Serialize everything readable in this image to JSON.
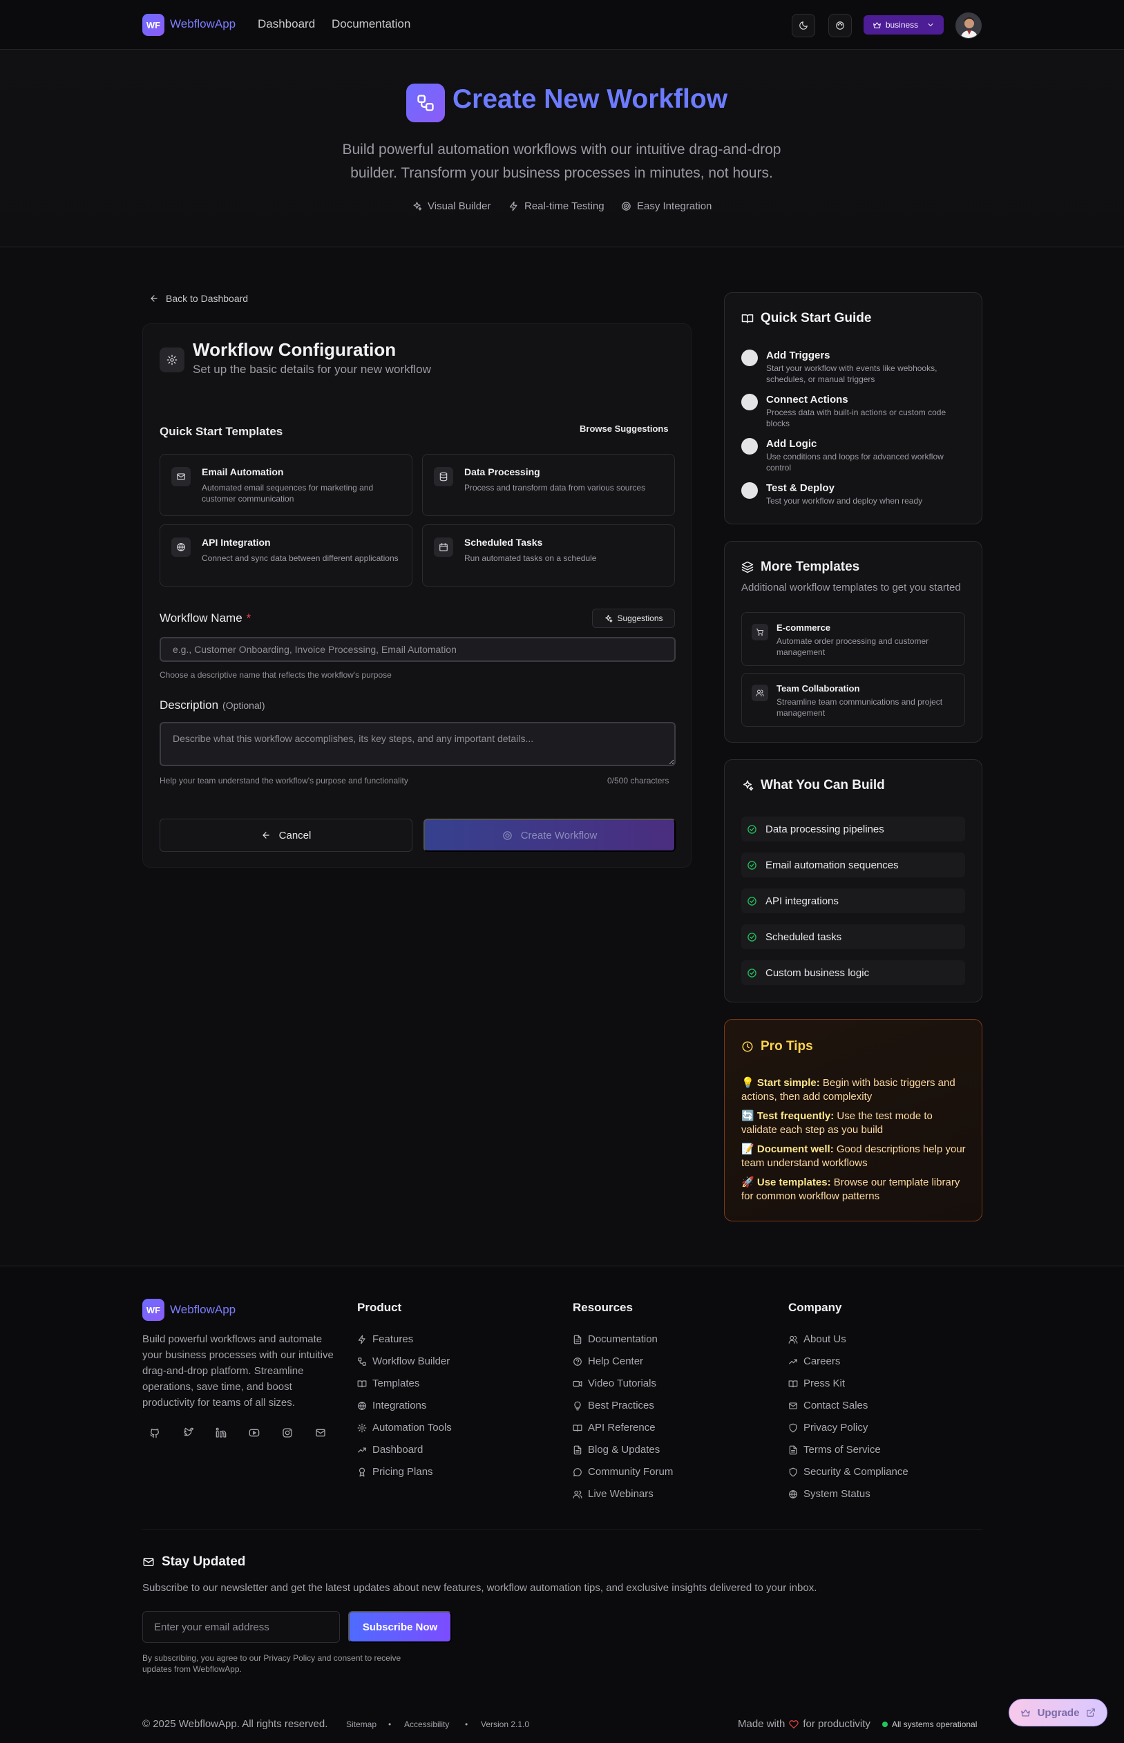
{
  "brand": {
    "logo_initials": "WF",
    "name": "WebflowApp",
    "accent": "#6d6cff"
  },
  "nav": {
    "links": [
      "Dashboard",
      "Documentation"
    ],
    "plan_badge": "business",
    "icons": [
      "moon-icon",
      "palette-icon",
      "crown-icon",
      "chevron-down-icon"
    ]
  },
  "hero": {
    "title": "Create New Workflow",
    "subtitle": "Build powerful automation workflows with our intuitive drag-and-drop builder. Transform your business processes in minutes, not hours.",
    "features": [
      "Visual Builder",
      "Real-time Testing",
      "Easy Integration"
    ]
  },
  "back_link": "Back to Dashboard",
  "config": {
    "title": "Workflow Configuration",
    "subtitle": "Set up the basic details for your new workflow",
    "templates_heading": "Quick Start Templates",
    "browse_label": "Browse Suggestions",
    "templates": [
      {
        "title": "Email Automation",
        "desc": "Automated email sequences for marketing and customer communication",
        "icon": "mail-icon"
      },
      {
        "title": "Data Processing",
        "desc": "Process and transform data from various sources",
        "icon": "database-icon"
      },
      {
        "title": "API Integration",
        "desc": "Connect and sync data between different applications",
        "icon": "globe-icon"
      },
      {
        "title": "Scheduled Tasks",
        "desc": "Run automated tasks on a schedule",
        "icon": "calendar-icon"
      }
    ],
    "name_label": "Workflow Name",
    "name_required": "*",
    "suggestions_label": "Suggestions",
    "name_placeholder": "e.g., Customer Onboarding, Invoice Processing, Email Automation",
    "name_value": "",
    "name_hint": "Choose a descriptive name that reflects the workflow's purpose",
    "desc_label": "Description",
    "desc_optional": "(Optional)",
    "desc_placeholder": "Describe what this workflow accomplishes, its key steps, and any important details...",
    "desc_value": "",
    "desc_hint": "Help your team understand the workflow's purpose and functionality",
    "char_count": "0/500 characters",
    "cancel_label": "Cancel",
    "create_label": "Create Workflow"
  },
  "quick_start": {
    "title": "Quick Start Guide",
    "steps": [
      {
        "title": "Add Triggers",
        "desc": "Start your workflow with events like webhooks, schedules, or manual triggers"
      },
      {
        "title": "Connect Actions",
        "desc": "Process data with built-in actions or custom code blocks"
      },
      {
        "title": "Add Logic",
        "desc": "Use conditions and loops for advanced workflow control"
      },
      {
        "title": "Test & Deploy",
        "desc": "Test your workflow and deploy when ready"
      }
    ]
  },
  "more_templates": {
    "title": "More Templates",
    "subtitle": "Additional workflow templates to get you started",
    "items": [
      {
        "title": "E-commerce",
        "desc": "Automate order processing and customer management",
        "icon": "cart-icon"
      },
      {
        "title": "Team Collaboration",
        "desc": "Streamline team communications and project management",
        "icon": "users-icon"
      }
    ]
  },
  "build": {
    "title": "What You Can Build",
    "items": [
      "Data processing pipelines",
      "Email automation sequences",
      "API integrations",
      "Scheduled tasks",
      "Custom business logic"
    ]
  },
  "tips": {
    "title": "Pro Tips",
    "items": [
      {
        "emoji": "💡",
        "bold": "Start simple:",
        "text": " Begin with basic triggers and actions, then add complexity"
      },
      {
        "emoji": "🔄",
        "bold": "Test frequently:",
        "text": " Use the test mode to validate each step as you build"
      },
      {
        "emoji": "📝",
        "bold": "Document well:",
        "text": " Good descriptions help your team understand workflows"
      },
      {
        "emoji": "🚀",
        "bold": "Use templates:",
        "text": " Browse our template library for common workflow patterns"
      }
    ]
  },
  "footer": {
    "description": "Build powerful workflows and automate your business processes with our intuitive drag-and-drop platform. Streamline operations, save time, and boost productivity for teams of all sizes.",
    "social_icons": [
      "github-icon",
      "twitter-icon",
      "linkedin-icon",
      "youtube-icon",
      "instagram-icon",
      "mail-icon"
    ],
    "columns": [
      {
        "title": "Product",
        "links": [
          "Features",
          "Workflow Builder",
          "Templates",
          "Integrations",
          "Automation Tools",
          "Dashboard",
          "Pricing Plans"
        ]
      },
      {
        "title": "Resources",
        "links": [
          "Documentation",
          "Help Center",
          "Video Tutorials",
          "Best Practices",
          "API Reference",
          "Blog & Updates",
          "Community Forum",
          "Live Webinars"
        ]
      },
      {
        "title": "Company",
        "links": [
          "About Us",
          "Careers",
          "Press Kit",
          "Contact Sales",
          "Privacy Policy",
          "Terms of Service",
          "Security & Compliance",
          "System Status"
        ]
      }
    ],
    "newsletter": {
      "title": "Stay Updated",
      "subtitle": "Subscribe to our newsletter and get the latest updates about new features, workflow automation tips, and exclusive insights delivered to your inbox.",
      "placeholder": "Enter your email address",
      "button": "Subscribe Now",
      "legal": "By subscribing, you agree to our Privacy Policy and consent to receive updates from WebflowApp."
    },
    "copyright": "© 2025 WebflowApp. All rights reserved.",
    "bottom_links": [
      "Sitemap",
      "Accessibility",
      "Version 2.1.0"
    ],
    "made_with_prefix": "Made with",
    "made_with_suffix": "for productivity",
    "status": "All systems operational"
  },
  "upgrade_label": "Upgrade"
}
